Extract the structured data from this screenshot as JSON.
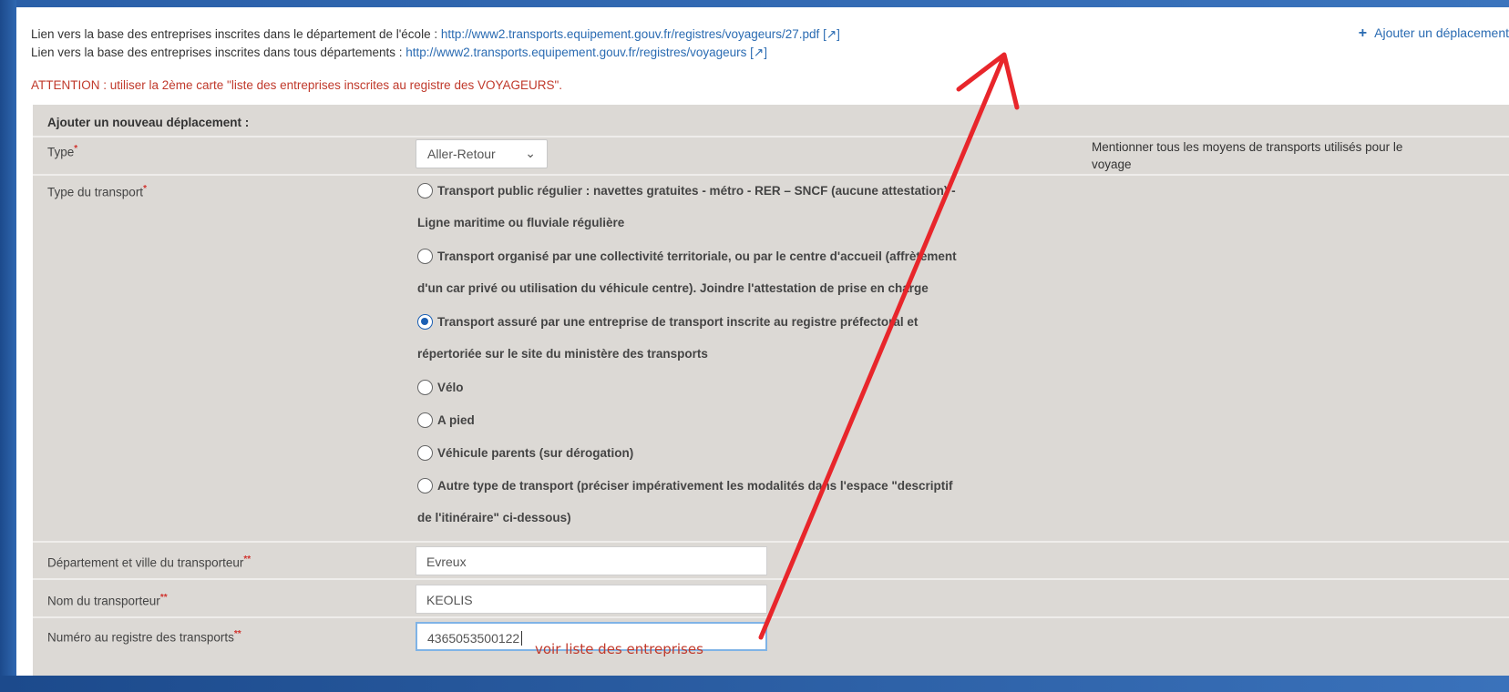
{
  "header": {
    "link1_prefix": "Lien vers la base des entreprises inscrites dans le département de l'école : ",
    "link1_url": "http://www2.transports.equipement.gouv.fr/registres/voyageurs/27.pdf",
    "link2_prefix": "Lien vers la base des entreprises inscrites dans tous départements : ",
    "link2_url": "http://www2.transports.equipement.gouv.fr/registres/voyageurs",
    "external_marker": "[↗]",
    "add_trip": "Ajouter un déplacement",
    "warning": "ATTENTION : utiliser la 2ème carte \"liste des entreprises inscrites au registre des VOYAGEURS\"."
  },
  "form": {
    "title": "Ajouter un nouveau déplacement :",
    "type_label": "Type",
    "type_value": "Aller-Retour",
    "type_hint": "Mentionner tous les moyens de transports utilisés pour le voyage",
    "transport_label": "Type du transport",
    "options": [
      {
        "line1": "Transport public régulier : navettes gratuites - métro - RER – SNCF (aucune attestation) -",
        "line2": "Ligne maritime ou fluviale régulière",
        "checked": false
      },
      {
        "line1": "Transport organisé par une collectivité territoriale, ou par le centre d'accueil (affrètement",
        "line2": "d'un car privé ou utilisation du véhicule centre). Joindre l'attestation de prise en charge",
        "checked": false
      },
      {
        "line1": "Transport assuré par une entreprise de transport inscrite au registre préfectoral et",
        "line2": "répertoriée sur le site du ministère des transports",
        "checked": true
      },
      {
        "line1": "Vélo",
        "checked": false
      },
      {
        "line1": "A pied",
        "checked": false
      },
      {
        "line1": "Véhicule parents (sur dérogation)",
        "checked": false
      },
      {
        "line1": "Autre type de transport (préciser impérativement les modalités dans l'espace \"descriptif",
        "line2": "de l'itinéraire\" ci-dessous)",
        "checked": false
      }
    ],
    "dept_label": "Département et ville du transporteur",
    "dept_value": "Evreux",
    "name_label": "Nom du transporteur",
    "name_value": "KEOLIS",
    "registry_label": "Numéro au registre des transports",
    "registry_value": "4365053500122",
    "required_single": "*",
    "required_double": "**"
  },
  "annotation": {
    "text": "voir liste des entreprises",
    "color": "#e8262b"
  }
}
